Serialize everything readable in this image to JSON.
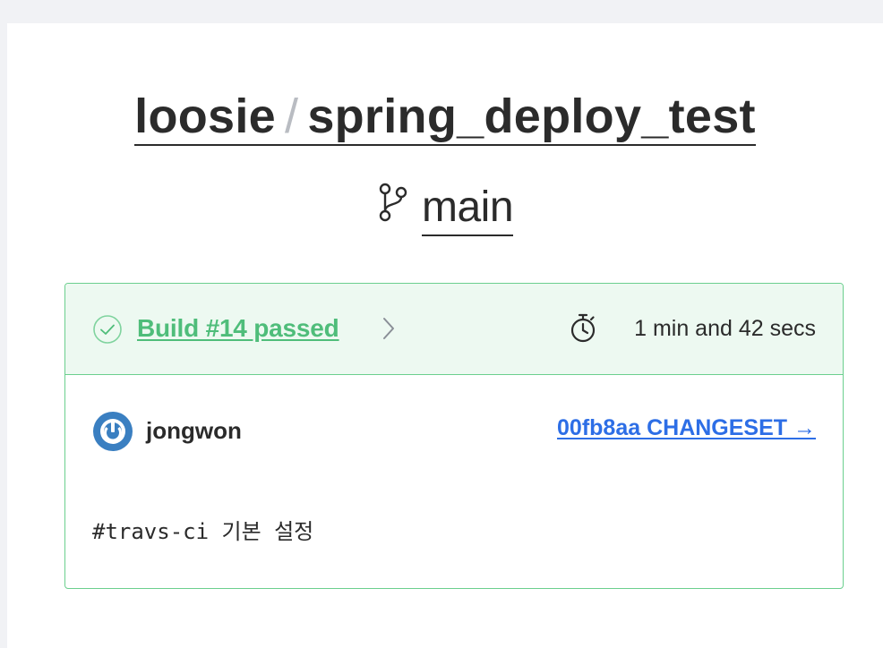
{
  "repository": {
    "owner": "loosie",
    "separator": "/",
    "name": "spring_deploy_test"
  },
  "branch": {
    "icon": "git-branch-icon",
    "name": "main"
  },
  "build": {
    "status_icon": "check-circle-icon",
    "label": "Build #14 passed",
    "status": "passed",
    "chevron_icon": "chevron-right-icon",
    "duration_icon": "stopwatch-icon",
    "duration": "1 min and 42 secs",
    "author_avatar_icon": "avatar-icon",
    "author": "jongwon",
    "changeset": "00fb8aa CHANGESET →",
    "commit_message": "#travs-ci 기본 설정"
  },
  "colors": {
    "passed_green": "#4fbd7a",
    "card_border": "#6bcf8e",
    "card_header_bg": "#edf9f1",
    "link_blue": "#2d6ee6",
    "text": "#2b2b2b",
    "page_bg": "#f1f2f5"
  }
}
